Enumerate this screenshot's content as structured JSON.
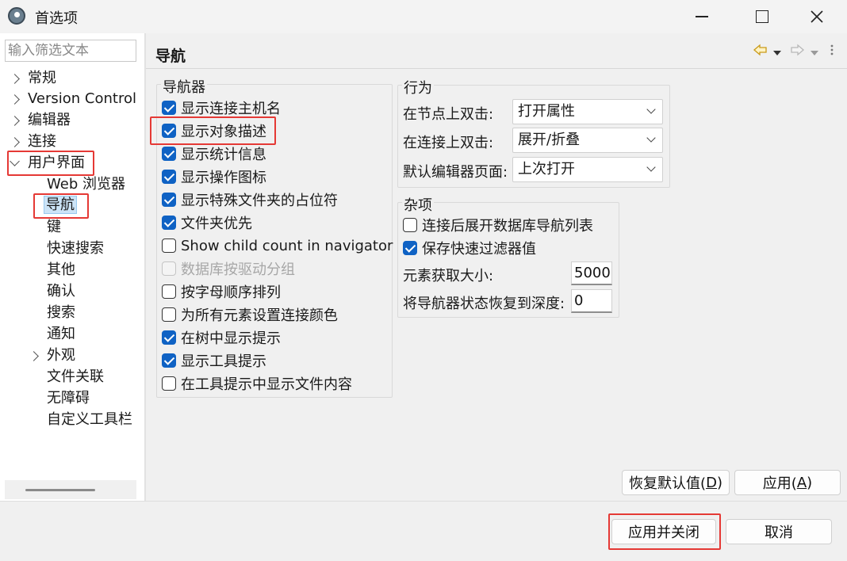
{
  "window": {
    "title": "首选项",
    "icon": "eclipse-app-icon"
  },
  "sidebar": {
    "filter_placeholder": "输入筛选文本",
    "items": [
      {
        "label": "常规",
        "expander": "collapsed"
      },
      {
        "label": "Version Control",
        "expander": "collapsed"
      },
      {
        "label": "编辑器",
        "expander": "collapsed"
      },
      {
        "label": "连接",
        "expander": "collapsed"
      },
      {
        "label": "用户界面",
        "expander": "expanded"
      },
      {
        "label": "Web 浏览器"
      },
      {
        "label": "导航",
        "selected": true
      },
      {
        "label": "键"
      },
      {
        "label": "快速搜索"
      },
      {
        "label": "其他"
      },
      {
        "label": "确认"
      },
      {
        "label": "搜索"
      },
      {
        "label": "通知"
      },
      {
        "label": "外观",
        "expander": "collapsed"
      },
      {
        "label": "文件关联"
      },
      {
        "label": "无障碍"
      },
      {
        "label": "自定义工具栏"
      }
    ]
  },
  "page": {
    "title": "导航",
    "nav_icons": [
      "back-arrow-icon",
      "dropdown-icon",
      "forward-arrow-icon",
      "dropdown-icon",
      "more-vert-icon"
    ]
  },
  "navigator_group": {
    "label": "导航器",
    "options": [
      {
        "label": "显示连接主机名",
        "checked": true
      },
      {
        "label": "显示对象描述",
        "checked": true
      },
      {
        "label": "显示统计信息",
        "checked": true
      },
      {
        "label": "显示操作图标",
        "checked": true
      },
      {
        "label": "显示特殊文件夹的占位符",
        "checked": true
      },
      {
        "label": "文件夹优先",
        "checked": true
      },
      {
        "label": "Show child count in navigator",
        "checked": false
      },
      {
        "label": "数据库按驱动分组",
        "checked": false,
        "disabled": true
      },
      {
        "label": "按字母顺序排列",
        "checked": false
      },
      {
        "label": "为所有元素设置连接颜色",
        "checked": false
      },
      {
        "label": "在树中显示提示",
        "checked": true
      },
      {
        "label": "显示工具提示",
        "checked": true
      },
      {
        "label": "在工具提示中显示文件内容",
        "checked": false
      }
    ]
  },
  "behavior_group": {
    "label": "行为",
    "rows": [
      {
        "label": "在节点上双击:",
        "value": "打开属性"
      },
      {
        "label": "在连接上双击:",
        "value": "展开/折叠"
      },
      {
        "label": "默认编辑器页面:",
        "value": "上次打开"
      }
    ]
  },
  "misc_group": {
    "label": "杂项",
    "options": [
      {
        "label": "连接后展开数据库导航列表",
        "checked": false
      },
      {
        "label": "保存快速过滤器值",
        "checked": true
      }
    ],
    "fetch_size_label": "元素获取大小:",
    "fetch_size_value": "5000",
    "restore_depth_label": "将导航器状态恢复到深度:",
    "restore_depth_value": "0"
  },
  "buttons": {
    "restore_defaults_text": "恢复默认值(",
    "restore_defaults_key": "D",
    "restore_defaults_end": ")",
    "apply_text": "应用(",
    "apply_key": "A",
    "apply_end": ")",
    "apply_close": "应用并关闭",
    "cancel": "取消"
  },
  "colors": {
    "highlight": "#e53935",
    "checkbox_on": "#0f62c4",
    "selection": "#cce4f7"
  }
}
